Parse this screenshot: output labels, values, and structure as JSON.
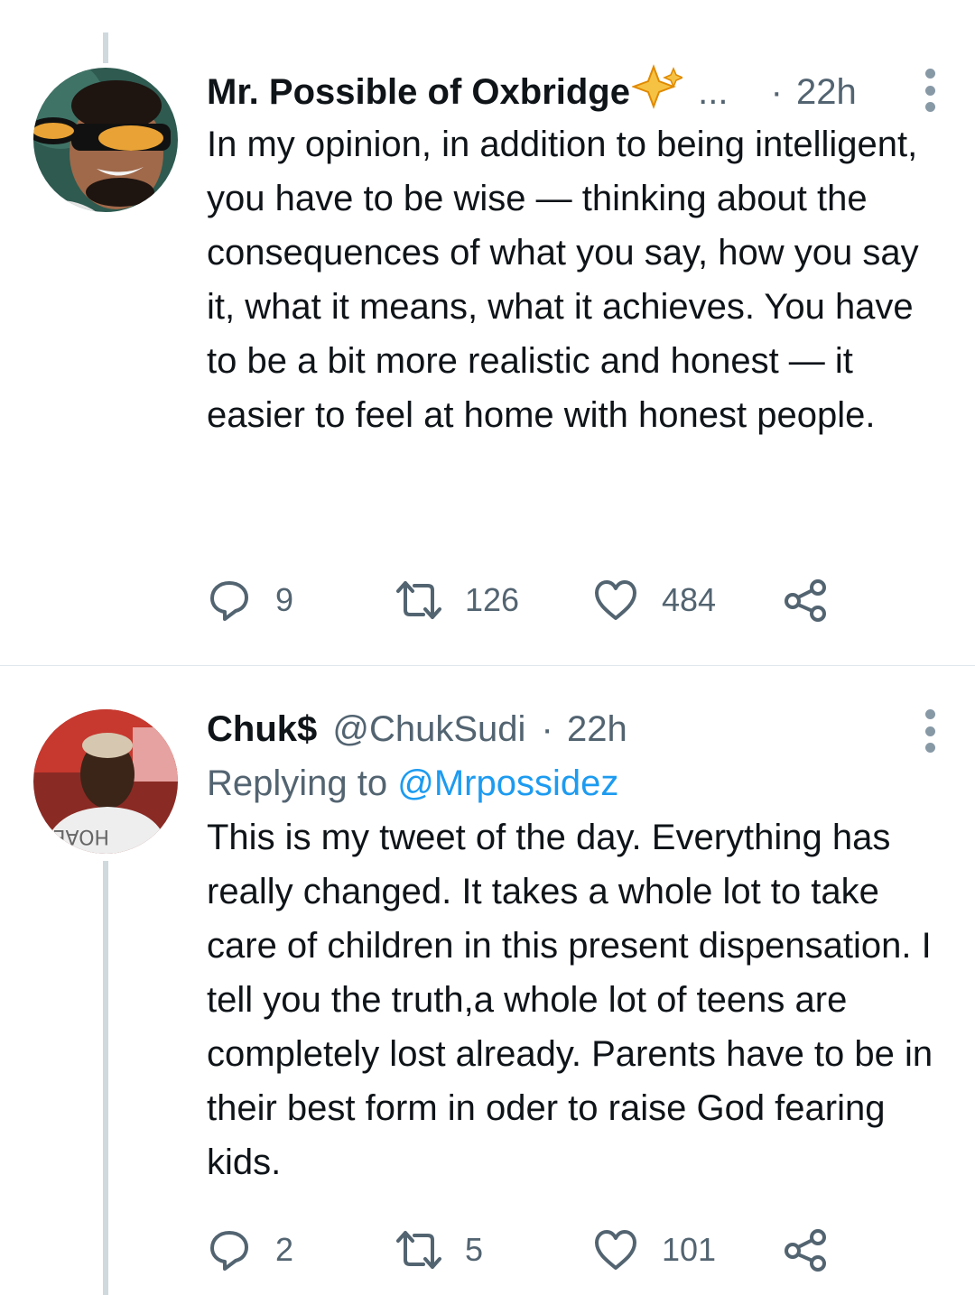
{
  "tweets": [
    {
      "display_name": "Mr. Possible of Oxbridge",
      "badge_icon": "sparkle-icon",
      "ellipsis": "...",
      "separator": "·",
      "time": "22h",
      "replying_prefix": "",
      "replying_handle": "",
      "text": "In my opinion, in addition to being intelligent, you have to be wise — thinking about the consequences of what you say, how you say it, what it means, what it achieves. You have to be a bit more realistic and honest — it easier to feel at home with honest people.",
      "stats": {
        "replies": "9",
        "retweets": "126",
        "likes": "484"
      }
    },
    {
      "display_name": "Chuk$",
      "handle": "@ChukSudi",
      "separator": "·",
      "time": "22h",
      "replying_prefix": "Replying to",
      "replying_handle": "@Mrpossidez",
      "avatar_shirt_text": "HOAE",
      "text": "This is my tweet of the day. Everything has really changed. It takes a whole lot to take care of  children in this present dispensation. I tell you the truth,a whole lot of teens are completely lost already. Parents have to be in their best form in oder to raise God fearing kids.",
      "stats": {
        "replies": "2",
        "retweets": "5",
        "likes": "101"
      }
    }
  ],
  "colors": {
    "text_primary": "#0f1419",
    "text_secondary": "#536471",
    "link": "#1d9bf0",
    "thread_line": "#cfd9de",
    "badge_gold": "#f4b400"
  }
}
